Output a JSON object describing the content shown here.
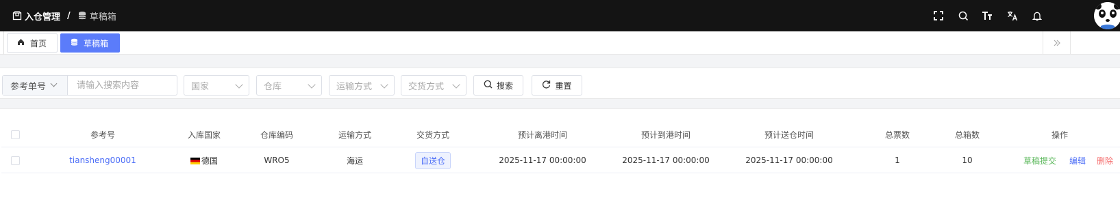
{
  "header": {
    "breadcrumb": [
      "入仓管理",
      "草稿箱"
    ],
    "separator": "/",
    "tools": [
      "fullscreen-icon",
      "search-icon",
      "font-size-icon",
      "translate-icon",
      "bell-icon"
    ]
  },
  "tabs": [
    {
      "label": "首页",
      "icon": "home-icon",
      "active": false
    },
    {
      "label": "草稿箱",
      "icon": "database-icon",
      "active": true
    }
  ],
  "filters": {
    "field_select": "参考单号",
    "search_placeholder": "请输入搜索内容",
    "country_placeholder": "国家",
    "warehouse_placeholder": "仓库",
    "transport_placeholder": "运输方式",
    "delivery_placeholder": "交货方式",
    "search_label": "搜索",
    "reset_label": "重置"
  },
  "table": {
    "columns": [
      "参考号",
      "入库国家",
      "仓库编码",
      "运输方式",
      "交货方式",
      "预计离港时间",
      "预计到港时间",
      "预计送仓时间",
      "总票数",
      "总箱数",
      "操作"
    ],
    "rows": [
      {
        "ref": "tiansheng00001",
        "country": "德国",
        "warehouse": "WRO5",
        "transport": "海运",
        "delivery": "自送仓",
        "etd": "2025-11-17 00:00:00",
        "eta": "2025-11-17 00:00:00",
        "delivery_time": "2025-11-17 00:00:00",
        "tickets": "1",
        "boxes": "10",
        "actions": {
          "submit": "草稿提交",
          "edit": "编辑",
          "delete": "删除"
        }
      }
    ]
  },
  "colors": {
    "accent": "#5b7cfa",
    "topbar": "#141414",
    "green": "#5cb85c",
    "red": "#f56c6c"
  }
}
